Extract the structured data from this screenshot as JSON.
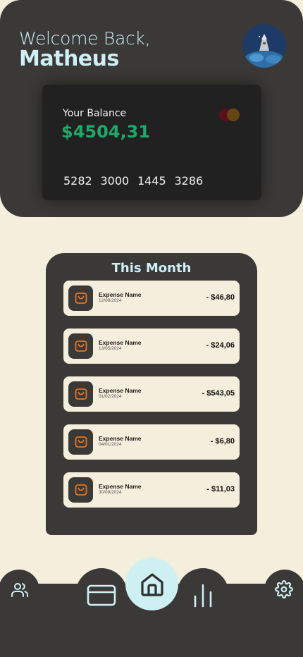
{
  "header": {
    "welcome": "Welcome Back,",
    "username": "Matheus"
  },
  "card": {
    "label": "Your Balance",
    "balance": "$4504,31",
    "numbers": [
      "5282",
      "3000",
      "1445",
      "3286"
    ]
  },
  "month": {
    "title": "This Month",
    "expenses": [
      {
        "name": "Expense Name",
        "date": "12/08/2024",
        "amount": "- $46,80"
      },
      {
        "name": "Expense Name",
        "date": "13/05/2024",
        "amount": "- $24,06"
      },
      {
        "name": "Expense Name",
        "date": "01/02/2024",
        "amount": "- $543,05"
      },
      {
        "name": "Expense Name",
        "date": "04/01/2024",
        "amount": "- $6,80"
      },
      {
        "name": "Expense Name",
        "date": "30/09/2024",
        "amount": "- $11,03"
      }
    ]
  },
  "nav": {
    "items": [
      "users-icon",
      "card-icon",
      "home-icon",
      "stats-icon",
      "settings-icon"
    ]
  },
  "colors": {
    "accent": "#cfeff4",
    "dark": "#3a3938",
    "background": "#f3efdc",
    "balance": "#1fa86a",
    "expense_icon": "#e8731e"
  }
}
